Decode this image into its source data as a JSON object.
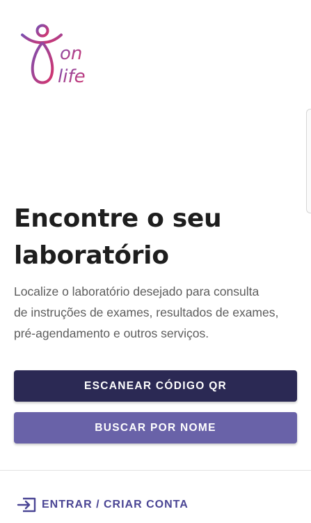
{
  "brand": {
    "logo_icon": "onlife-person-icon",
    "logo_text_line1": "on",
    "logo_text_line2": "life",
    "gradient_start": "#7b4fb0",
    "gradient_end": "#d6336c"
  },
  "main": {
    "headline_line1": "Encontre o seu",
    "headline_line2": "laboratório",
    "description_line1": "Localize o laboratório desejado para consulta",
    "description_line2": "de instruções de exames, resultados de exames,",
    "description_line3": "pré-agendamento e outros serviços."
  },
  "actions": {
    "scan_qr_label": "ESCANEAR CÓDIGO QR",
    "search_by_name_label": "BUSCAR POR NOME",
    "primary_color": "#2b2954",
    "secondary_color": "#6962a8"
  },
  "footer": {
    "login_label": "ENTRAR / CRIAR CONTA",
    "login_icon": "login-enter-icon",
    "link_color": "#4a4594"
  }
}
